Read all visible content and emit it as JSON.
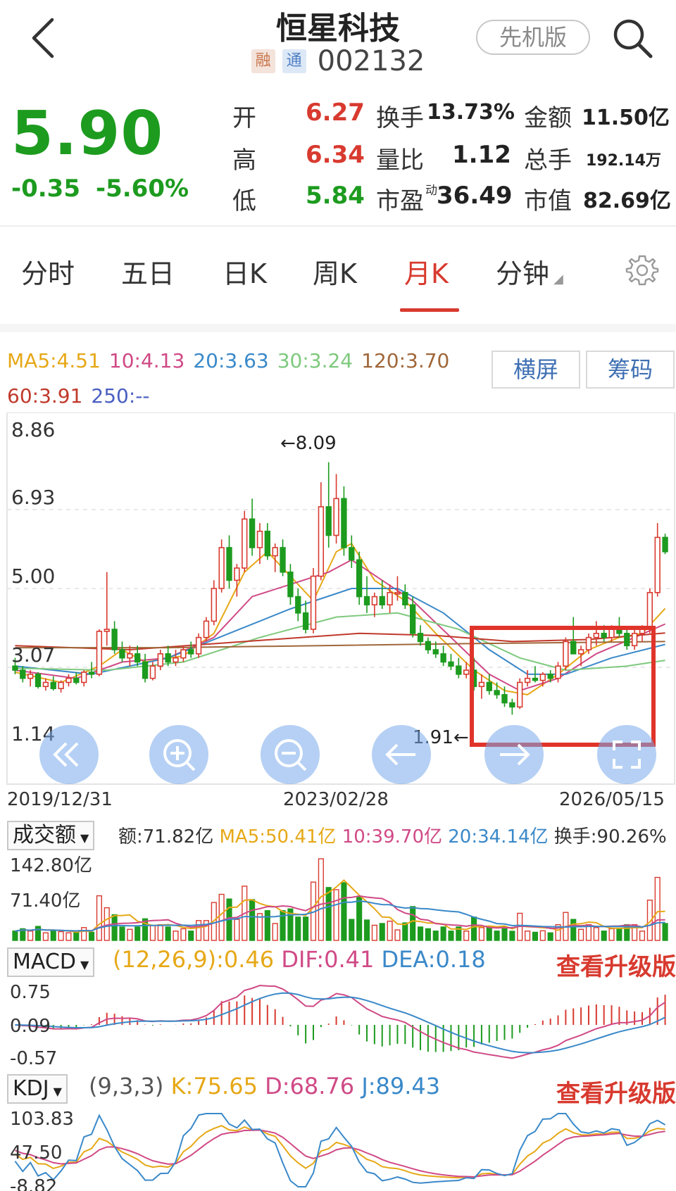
{
  "header": {
    "title": "恒星科技",
    "tag_rong": "融",
    "tag_tong": "通",
    "code": "002132",
    "pro_label": "先机版"
  },
  "quote": {
    "price": "5.90",
    "change": "-0.35",
    "change_pct": "-5.60%",
    "open_label": "开",
    "open": "6.27",
    "high_label": "高",
    "high": "6.34",
    "low_label": "低",
    "low": "5.84",
    "turnover_label": "换手",
    "turnover": "13.73%",
    "vol_ratio_label": "量比",
    "vol_ratio": "1.12",
    "pe_label": "市盈",
    "pe_sup": "动",
    "pe": "36.49",
    "amount_label": "金额",
    "amount": "11.50亿",
    "total_hands_label": "总手",
    "total_hands": "192.14万",
    "mkt_cap_label": "市值",
    "mkt_cap": "82.69亿"
  },
  "tabs": [
    "分时",
    "五日",
    "日K",
    "周K",
    "月K",
    "分钟"
  ],
  "active_tab": "月K",
  "ma_legend": {
    "ma5": "MA5:4.51",
    "ma10": "10:4.13",
    "ma20": "20:3.63",
    "ma30": "30:3.24",
    "ma120": "120:3.70",
    "ma60": "60:3.91",
    "ma250": "250:--"
  },
  "buttons": {
    "landscape": "横屏",
    "chips": "筹码"
  },
  "colors": {
    "up": "#d83a2f",
    "down": "#1d9b1f",
    "ma5": "#e6a817",
    "ma10": "#d04a86",
    "ma20": "#3a89c9",
    "ma30": "#7ec97e",
    "ma120": "#a0673a",
    "ma60": "#c0392b",
    "ma250": "#4a5fc1"
  },
  "chart_data": {
    "type": "candlestick",
    "price_axis_ticks": [
      "8.86",
      "6.93",
      "5.00",
      "3.07",
      "1.14"
    ],
    "ylim": [
      1.14,
      8.86
    ],
    "date_labels": [
      "2019/12/31",
      "2023/02/28",
      "2026/05/15"
    ],
    "high_marker": "8.09",
    "low_marker": "1.91",
    "candles": [
      [
        3.1,
        3.3,
        2.9,
        3.0
      ],
      [
        3.0,
        3.1,
        2.7,
        2.8
      ],
      [
        2.8,
        3.0,
        2.6,
        2.9
      ],
      [
        2.9,
        2.95,
        2.55,
        2.6
      ],
      [
        2.6,
        2.8,
        2.5,
        2.7
      ],
      [
        2.7,
        2.85,
        2.5,
        2.55
      ],
      [
        2.55,
        2.75,
        2.45,
        2.7
      ],
      [
        2.7,
        2.9,
        2.6,
        2.8
      ],
      [
        2.8,
        2.95,
        2.65,
        2.7
      ],
      [
        2.7,
        3.0,
        2.6,
        2.95
      ],
      [
        2.95,
        3.2,
        2.8,
        2.9
      ],
      [
        2.9,
        4.0,
        2.85,
        3.95
      ],
      [
        3.95,
        5.4,
        3.6,
        4.0
      ],
      [
        4.0,
        4.2,
        3.4,
        3.5
      ],
      [
        3.5,
        3.7,
        3.2,
        3.3
      ],
      [
        3.3,
        3.6,
        3.1,
        3.4
      ],
      [
        3.4,
        3.6,
        3.1,
        3.2
      ],
      [
        3.2,
        3.4,
        2.7,
        2.8
      ],
      [
        2.8,
        3.2,
        2.75,
        3.1
      ],
      [
        3.1,
        3.5,
        3.0,
        3.4
      ],
      [
        3.4,
        3.6,
        3.1,
        3.2
      ],
      [
        3.2,
        3.5,
        3.1,
        3.3
      ],
      [
        3.3,
        3.6,
        3.2,
        3.5
      ],
      [
        3.5,
        3.7,
        3.3,
        3.4
      ],
      [
        3.4,
        3.9,
        3.3,
        3.8
      ],
      [
        3.8,
        4.3,
        3.7,
        4.2
      ],
      [
        4.2,
        5.2,
        4.1,
        5.0
      ],
      [
        5.0,
        6.2,
        4.9,
        6.0
      ],
      [
        6.0,
        6.3,
        5.0,
        5.2
      ],
      [
        5.2,
        5.6,
        4.8,
        5.5
      ],
      [
        5.5,
        6.9,
        5.4,
        6.7
      ],
      [
        6.7,
        7.2,
        5.8,
        6.0
      ],
      [
        6.0,
        6.6,
        5.6,
        6.4
      ],
      [
        6.4,
        6.6,
        5.7,
        5.8
      ],
      [
        5.8,
        6.1,
        5.4,
        6.0
      ],
      [
        6.0,
        6.2,
        5.3,
        5.4
      ],
      [
        5.4,
        5.6,
        4.6,
        4.8
      ],
      [
        4.8,
        5.0,
        4.2,
        4.4
      ],
      [
        4.4,
        4.7,
        3.9,
        4.0
      ],
      [
        4.0,
        5.5,
        3.9,
        5.3
      ],
      [
        5.3,
        7.6,
        5.2,
        7.0
      ],
      [
        7.0,
        8.09,
        6.0,
        6.3
      ],
      [
        6.3,
        7.8,
        6.1,
        7.2
      ],
      [
        7.2,
        7.5,
        5.8,
        6.0
      ],
      [
        6.0,
        6.3,
        5.5,
        5.7
      ],
      [
        5.7,
        5.9,
        4.6,
        4.8
      ],
      [
        4.8,
        5.3,
        4.4,
        4.6
      ],
      [
        4.6,
        4.9,
        4.3,
        4.8
      ],
      [
        4.8,
        5.2,
        4.5,
        4.6
      ],
      [
        4.6,
        5.1,
        4.4,
        4.9
      ],
      [
        4.9,
        5.3,
        4.7,
        4.9
      ],
      [
        4.9,
        5.1,
        4.5,
        4.6
      ],
      [
        4.6,
        4.8,
        3.8,
        3.9
      ],
      [
        3.9,
        4.1,
        3.6,
        3.7
      ],
      [
        3.7,
        3.8,
        3.4,
        3.5
      ],
      [
        3.5,
        3.7,
        3.3,
        3.4
      ],
      [
        3.4,
        3.6,
        3.1,
        3.2
      ],
      [
        3.2,
        3.4,
        3.0,
        3.1
      ],
      [
        3.1,
        3.3,
        2.8,
        2.9
      ],
      [
        2.9,
        3.2,
        2.8,
        3.0
      ],
      [
        3.0,
        3.3,
        2.5,
        2.6
      ],
      [
        2.6,
        2.9,
        2.3,
        2.7
      ],
      [
        2.7,
        2.9,
        2.4,
        2.5
      ],
      [
        2.5,
        2.7,
        2.3,
        2.4
      ],
      [
        2.4,
        2.6,
        2.1,
        2.2
      ],
      [
        2.2,
        2.3,
        1.91,
        2.1
      ],
      [
        2.1,
        2.8,
        2.05,
        2.7
      ],
      [
        2.7,
        3.0,
        2.6,
        2.8
      ],
      [
        2.8,
        3.1,
        2.7,
        2.75
      ],
      [
        2.75,
        2.95,
        2.6,
        2.9
      ],
      [
        2.9,
        3.0,
        2.7,
        2.8
      ],
      [
        2.8,
        3.2,
        2.7,
        3.1
      ],
      [
        3.1,
        3.8,
        3.0,
        3.7
      ],
      [
        3.7,
        4.3,
        3.5,
        3.4
      ],
      [
        3.4,
        3.6,
        3.1,
        3.5
      ],
      [
        3.5,
        3.9,
        3.4,
        3.8
      ],
      [
        3.8,
        4.2,
        3.6,
        3.9
      ],
      [
        3.9,
        4.1,
        3.7,
        3.8
      ],
      [
        3.8,
        4.1,
        3.7,
        4.0
      ],
      [
        4.0,
        4.3,
        3.8,
        3.9
      ],
      [
        3.9,
        4.0,
        3.5,
        3.6
      ],
      [
        3.6,
        4.0,
        3.5,
        3.9
      ],
      [
        3.9,
        4.1,
        3.7,
        4.0
      ],
      [
        4.0,
        5.0,
        3.9,
        4.9
      ],
      [
        4.9,
        6.6,
        4.8,
        6.25
      ],
      [
        6.25,
        6.34,
        5.84,
        5.9
      ]
    ],
    "ma_series": {
      "ma5": [
        [
          0,
          2.95
        ],
        [
          6,
          2.7
        ],
        [
          11,
          3.1
        ],
        [
          14,
          3.5
        ],
        [
          17,
          3.2
        ],
        [
          22,
          3.35
        ],
        [
          26,
          3.9
        ],
        [
          30,
          5.4
        ],
        [
          33,
          5.9
        ],
        [
          36,
          5.3
        ],
        [
          39,
          4.7
        ],
        [
          42,
          5.9
        ],
        [
          44,
          6.1
        ],
        [
          47,
          5.2
        ],
        [
          51,
          4.7
        ],
        [
          55,
          3.9
        ],
        [
          60,
          3.0
        ],
        [
          64,
          2.5
        ],
        [
          67,
          2.4
        ],
        [
          71,
          2.9
        ],
        [
          75,
          3.5
        ],
        [
          79,
          3.8
        ],
        [
          82,
          3.9
        ],
        [
          85,
          4.51
        ]
      ],
      "ma10": [
        [
          0,
          3.0
        ],
        [
          8,
          2.8
        ],
        [
          14,
          3.2
        ],
        [
          20,
          3.3
        ],
        [
          26,
          3.8
        ],
        [
          31,
          4.8
        ],
        [
          36,
          5.1
        ],
        [
          41,
          5.4
        ],
        [
          44,
          5.7
        ],
        [
          48,
          5.2
        ],
        [
          52,
          4.7
        ],
        [
          57,
          3.8
        ],
        [
          62,
          2.9
        ],
        [
          66,
          2.5
        ],
        [
          71,
          2.8
        ],
        [
          76,
          3.4
        ],
        [
          81,
          3.8
        ],
        [
          85,
          4.13
        ]
      ],
      "ma20": [
        [
          0,
          3.1
        ],
        [
          10,
          2.9
        ],
        [
          20,
          3.3
        ],
        [
          28,
          3.9
        ],
        [
          36,
          4.5
        ],
        [
          44,
          5.0
        ],
        [
          50,
          5.0
        ],
        [
          56,
          4.4
        ],
        [
          62,
          3.5
        ],
        [
          67,
          2.9
        ],
        [
          72,
          2.9
        ],
        [
          78,
          3.3
        ],
        [
          85,
          3.63
        ]
      ],
      "ma30": [
        [
          0,
          3.05
        ],
        [
          12,
          3.0
        ],
        [
          22,
          3.2
        ],
        [
          32,
          3.8
        ],
        [
          42,
          4.3
        ],
        [
          50,
          4.4
        ],
        [
          58,
          4.0
        ],
        [
          66,
          3.3
        ],
        [
          72,
          3.0
        ],
        [
          80,
          3.1
        ],
        [
          85,
          3.24
        ]
      ],
      "ma60": [
        [
          0,
          3.6
        ],
        [
          15,
          3.5
        ],
        [
          30,
          3.7
        ],
        [
          45,
          3.9
        ],
        [
          55,
          3.85
        ],
        [
          65,
          3.7
        ],
        [
          75,
          3.75
        ],
        [
          85,
          3.91
        ]
      ],
      "ma120": [
        [
          0,
          3.55
        ],
        [
          20,
          3.55
        ],
        [
          40,
          3.6
        ],
        [
          60,
          3.65
        ],
        [
          85,
          3.7
        ]
      ]
    }
  },
  "volume_panel": {
    "selector": "成交额",
    "amount": "额:71.82亿",
    "ma5": "MA5:50.41亿",
    "ma10": "10:39.70亿",
    "ma20": "20:34.14亿",
    "turnover": "换手:90.26%",
    "ticks": [
      "142.80亿",
      "71.40亿"
    ],
    "ylim": [
      0,
      142.8
    ]
  },
  "macd_panel": {
    "selector": "MACD",
    "params": "(12,26,9):0.46",
    "dif": "DIF:0.41",
    "dea": "DEA:0.18",
    "upgrade": "查看升级版",
    "ticks": [
      "0.75",
      "0.09",
      "-0.57"
    ],
    "ylim": [
      -0.57,
      0.75
    ]
  },
  "kdj_panel": {
    "selector": "KDJ",
    "params": "(9,3,3)",
    "k": "K:75.65",
    "d": "D:68.76",
    "j": "J:89.43",
    "upgrade": "查看升级版",
    "ticks": [
      "103.83",
      "47.50",
      "-8.82"
    ],
    "ylim": [
      -8.82,
      103.83
    ]
  }
}
